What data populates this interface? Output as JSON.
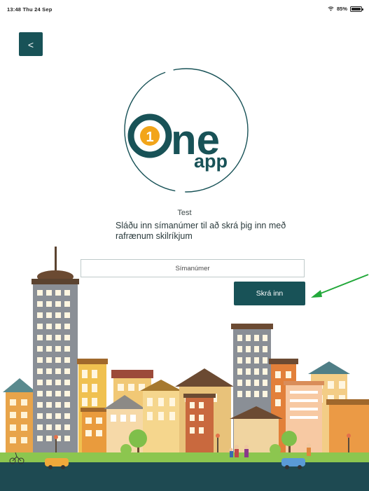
{
  "status_bar": {
    "time_date": "13:48  Thu 24 Sep",
    "battery": "85%",
    "battery_level": 0.85
  },
  "back_button": {
    "label": "<"
  },
  "logo": {
    "one_digit": "1",
    "one_text": "ne",
    "app_text": "app",
    "colors": {
      "teal": "#185257",
      "orange": "#f2a51a"
    }
  },
  "screen": {
    "test_label": "Test",
    "instructions": "Sláðu inn símanúmer til að skrá þig inn með rafrænum skilríkjum"
  },
  "phone_input": {
    "placeholder": "Símanúmer",
    "value": ""
  },
  "login_button": {
    "label": "Skrá inn"
  },
  "colors": {
    "primary": "#185257",
    "annotation_arrow": "#22a83a"
  }
}
